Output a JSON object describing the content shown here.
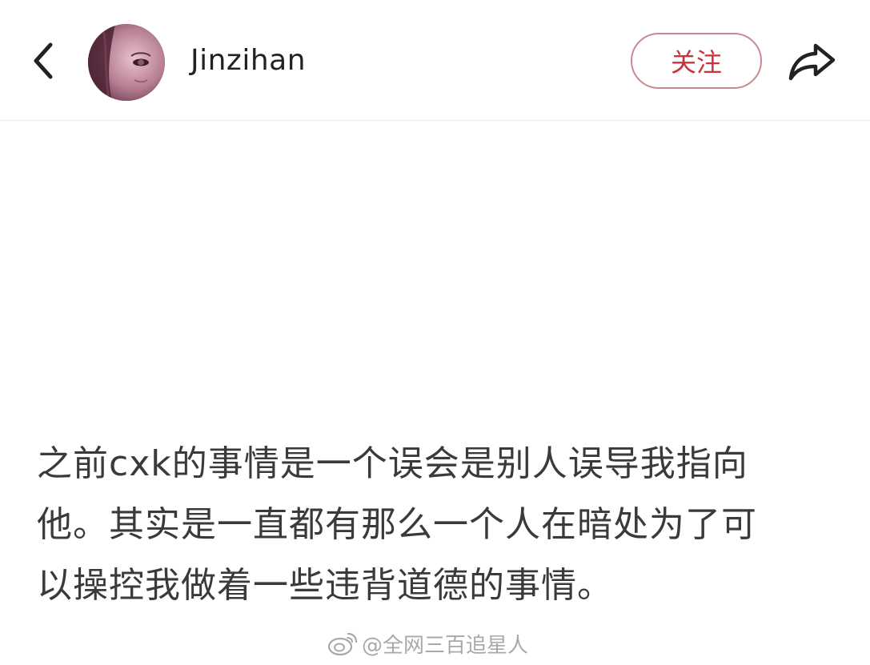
{
  "header": {
    "username": "Jinzihan",
    "follow_label": "关注",
    "back_icon": "chevron-left-icon",
    "share_icon": "share-arrow-icon",
    "accent_color": "#c8333d"
  },
  "post": {
    "lines": [
      "之前cxk的事情是一个误会是别人误导我指向",
      "他。其实是一直都有那么一个人在暗处为了可",
      "以操控我做着一些违背道德的事情。"
    ]
  },
  "watermark": {
    "text": "@全网三百追星人",
    "logo_icon": "weibo-logo-icon"
  }
}
